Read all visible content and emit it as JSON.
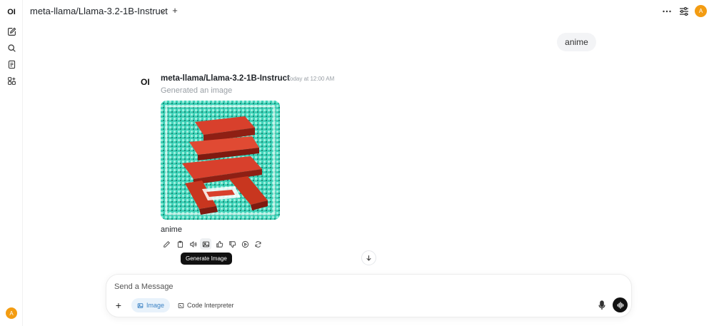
{
  "app": {
    "logo_text": "OI"
  },
  "sidebar": {
    "avatar_initial": "A",
    "items": [
      {
        "name": "new-chat",
        "icon": "pencil-square-icon"
      },
      {
        "name": "search",
        "icon": "search-icon"
      },
      {
        "name": "notes",
        "icon": "document-icon"
      },
      {
        "name": "workspace",
        "icon": "grid-icon"
      }
    ]
  },
  "header": {
    "model_name": "meta-llama/Llama-3.2-1B-Instruct",
    "avatar_initial": "A"
  },
  "chat": {
    "user_message": "anime",
    "assistant": {
      "logo_text": "OI",
      "model_name": "meta-llama/Llama-3.2-1B-Instruct",
      "timestamp": "Today at 12:00 AM",
      "status": "Generated an image",
      "caption": "anime"
    },
    "tooltip": "Generate Image"
  },
  "composer": {
    "placeholder": "Send a Message",
    "image_label": "Image",
    "code_label": "Code Interpreter"
  },
  "colors": {
    "accent": "#3b82c4",
    "avatar": "#f39c12",
    "image_teal": "#3fd2b8",
    "image_red": "#d8402c"
  }
}
